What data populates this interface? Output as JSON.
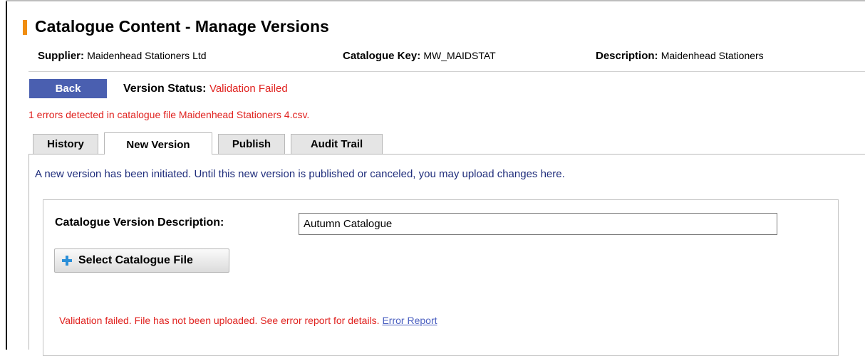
{
  "page_title": "Catalogue Content - Manage Versions",
  "meta": {
    "supplier_label": "Supplier:",
    "supplier_value": "Maidenhead Stationers Ltd",
    "catalogue_key_label": "Catalogue Key:",
    "catalogue_key_value": "MW_MAIDSTAT",
    "description_label": "Description:",
    "description_value": "Maidenhead Stationers"
  },
  "back_button": "Back",
  "version_status": {
    "label": "Version Status:",
    "value": "Validation Failed"
  },
  "error_message": "1 errors detected in catalogue file Maidenhead Stationers 4.csv.",
  "tabs": [
    {
      "label": "History"
    },
    {
      "label": "New Version",
      "active": true
    },
    {
      "label": "Publish"
    },
    {
      "label": "Audit Trail"
    }
  ],
  "info_message": "A new version has been initiated. Until this new version is published or canceled, you may upload changes here.",
  "form": {
    "description_label": "Catalogue Version Description:",
    "description_value": "Autumn Catalogue",
    "select_file_button": "Select Catalogue File",
    "select_file_icon": "plus-icon"
  },
  "validation": {
    "message": "Validation failed. File has not been uploaded. See error report for details.",
    "link": "Error Report"
  },
  "colors": {
    "accent": "#f08d11",
    "back_button": "#4a5fb0",
    "error": "#e0221f",
    "info_text": "#1f2d7b",
    "link": "#4a5fc0"
  }
}
